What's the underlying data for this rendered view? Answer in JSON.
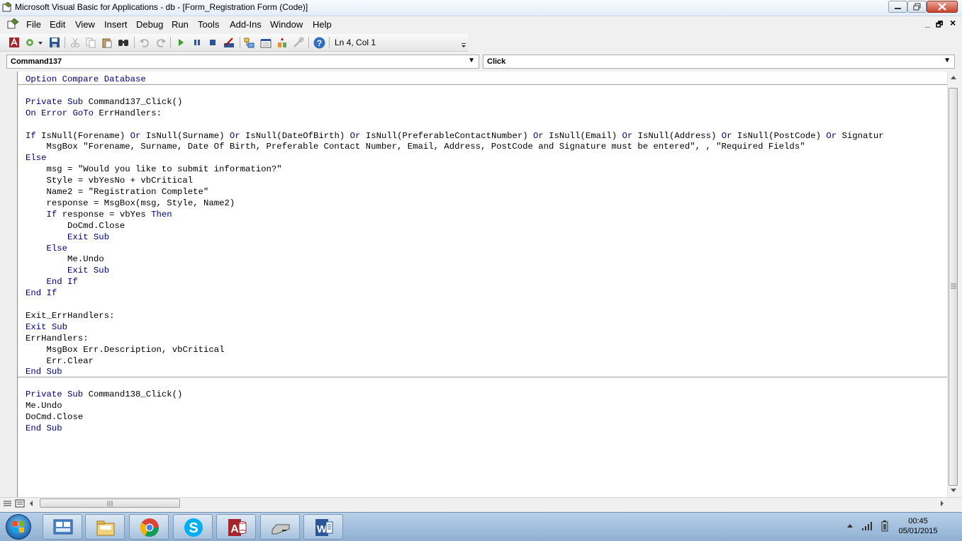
{
  "window": {
    "title": "Microsoft Visual Basic for Applications - db - [Form_Registration Form (Code)]"
  },
  "menu": [
    "File",
    "Edit",
    "View",
    "Insert",
    "Debug",
    "Run",
    "Tools",
    "Add-Ins",
    "Window",
    "Help"
  ],
  "mdi_controls": {
    "minimize": "_",
    "restore": "🗗",
    "close": "×"
  },
  "toolbar": {
    "position": "Ln 4, Col 1",
    "icons": [
      "access-icon",
      "insert-module-icon",
      "save-icon",
      "cut-icon",
      "copy-icon",
      "paste-icon",
      "find-icon",
      "undo-icon",
      "redo-icon",
      "run-icon",
      "break-icon",
      "reset-icon",
      "design-mode-icon",
      "project-explorer-icon",
      "properties-icon",
      "object-browser-icon",
      "toolbox-icon",
      "help-icon"
    ]
  },
  "object_combo": {
    "value": "Command137"
  },
  "procedure_combo": {
    "value": "Click"
  },
  "code": {
    "lines": [
      {
        "t": "Option Compare Database",
        "k": true
      },
      {
        "t": "",
        "k": false
      },
      {
        "t": "Private Sub Command137_Click()",
        "k": false
      },
      {
        "t": "On Error GoTo ErrHandlers:",
        "k": false
      },
      {
        "t": "",
        "k": false
      },
      {
        "t": "If IsNull(Forename) Or IsNull(Surname) Or IsNull(DateOfBirth) Or IsNull(PreferableContactNumber) Or IsNull(Email) Or IsNull(Address) Or IsNull(PostCode) Or Signatur",
        "k": false
      },
      {
        "t": "    MsgBox \"Forename, Surname, Date Of Birth, Preferable Contact Number, Email, Address, PostCode and Signature must be entered\", , \"Required Fields\"",
        "k": false
      },
      {
        "t": "Else",
        "k": true
      },
      {
        "t": "    msg = \"Would you like to submit information?\"",
        "k": false
      },
      {
        "t": "    Style = vbYesNo + vbCritical",
        "k": false
      },
      {
        "t": "    Name2 = \"Registration Complete\"",
        "k": false
      },
      {
        "t": "    response = MsgBox(msg, Style, Name2)",
        "k": false
      },
      {
        "t": "    If response = vbYes Then",
        "k": false
      },
      {
        "t": "        DoCmd.Close",
        "k": false
      },
      {
        "t": "        Exit Sub",
        "k": true
      },
      {
        "t": "    Else",
        "k": true
      },
      {
        "t": "        Me.Undo",
        "k": false
      },
      {
        "t": "        Exit Sub",
        "k": true
      },
      {
        "t": "    End If",
        "k": true
      },
      {
        "t": "End If",
        "k": true
      },
      {
        "t": "",
        "k": false
      },
      {
        "t": "Exit_ErrHandlers:",
        "k": false
      },
      {
        "t": "Exit Sub",
        "k": true
      },
      {
        "t": "ErrHandlers:",
        "k": false
      },
      {
        "t": "    MsgBox Err.Description, vbCritical",
        "k": false
      },
      {
        "t": "    Err.Clear",
        "k": false
      },
      {
        "t": "End Sub",
        "k": true
      },
      {
        "t": "",
        "k": false
      },
      {
        "t": "Private Sub Command138_Click()",
        "k": false
      },
      {
        "t": "Me.Undo",
        "k": false
      },
      {
        "t": "DoCmd.Close",
        "k": false
      },
      {
        "t": "End Sub",
        "k": true
      }
    ]
  },
  "colors": {
    "keyword": "#00007f",
    "text": "#000000",
    "code_bg": "#ffffff"
  },
  "taskbar": {
    "apps": [
      "windows-explorer-icon",
      "file-manager-icon",
      "chrome-icon",
      "skype-icon",
      "access-icon",
      "drive-icon",
      "word-icon"
    ],
    "clock_time": "00:45",
    "clock_date": "05/01/2015"
  }
}
